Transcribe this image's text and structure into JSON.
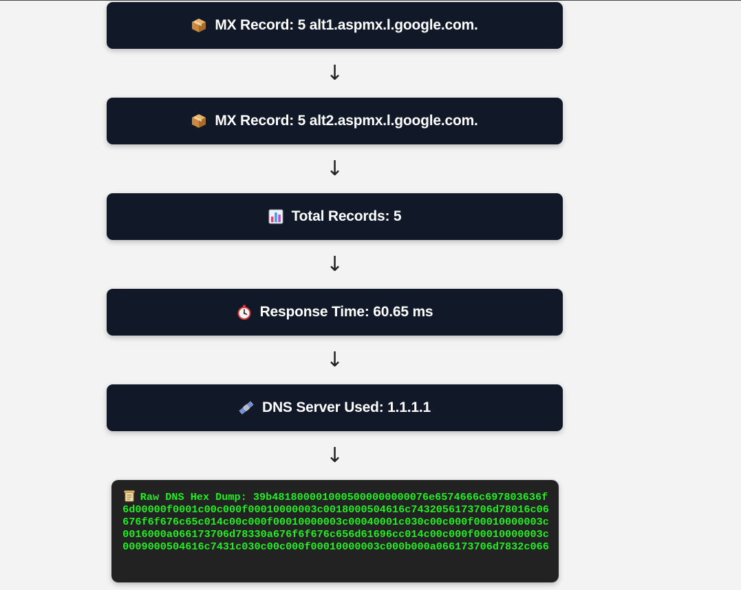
{
  "records": [
    {
      "icon": "package-icon",
      "label": "MX Record: 5 alt1.aspmx.l.google.com."
    },
    {
      "icon": "package-icon",
      "label": "MX Record: 5 alt2.aspmx.l.google.com."
    },
    {
      "icon": "bar-chart-icon",
      "label": "Total Records: 5"
    },
    {
      "icon": "stopwatch-icon",
      "label": "Response Time: 60.65 ms"
    },
    {
      "icon": "satellite-icon",
      "label": "DNS Server Used: 1.1.1.1"
    }
  ],
  "arrow_glyph": "↓",
  "hex_dump": {
    "icon": "scroll-icon",
    "label": "Raw DNS Hex Dump:",
    "value": "39b4818000010005000000000076e6574666c697803636f6d00000f0001c00c000f00010000003c0018000504616c7432056173706d78016c06676f6f676c65c014c00c000f00010000003c00040001c030c00c000f00010000003c0016000a066173706d78330a676f6f676c656d61696cc014c00c000f00010000003c0009000504616c7431c030c00c000f00010000003c000b000a066173706d7832c066"
  },
  "colors": {
    "page_bg": "#f3f3f3",
    "card_bg": "#111827",
    "card_text": "#ffffff",
    "hex_bg": "#222222",
    "hex_text": "#22ee22"
  }
}
